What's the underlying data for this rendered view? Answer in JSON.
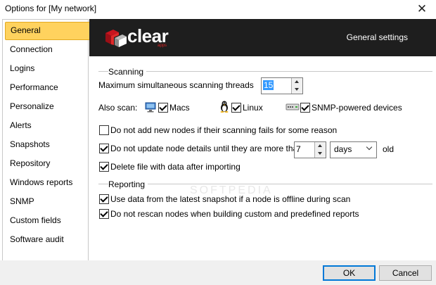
{
  "window": {
    "title": "Options for [My network]",
    "close_glyph": "✕"
  },
  "sidebar": {
    "items": [
      {
        "label": "General",
        "selected": true
      },
      {
        "label": "Connection"
      },
      {
        "label": "Logins"
      },
      {
        "label": "Performance"
      },
      {
        "label": "Personalize"
      },
      {
        "label": "Alerts"
      },
      {
        "label": "Snapshots"
      },
      {
        "label": "Repository"
      },
      {
        "label": "Windows reports"
      },
      {
        "label": "SNMP"
      },
      {
        "label": "Custom fields"
      },
      {
        "label": "Software audit"
      }
    ]
  },
  "header": {
    "logo_text": "clear",
    "logo_sub": "apps",
    "title": "General settings"
  },
  "scanning": {
    "group_label": "Scanning",
    "threads_label": "Maximum simultaneous scanning threads",
    "threads_value": "15",
    "also_scan_label": "Also scan:",
    "macs_label": "Macs",
    "macs_checked": true,
    "linux_label": "Linux",
    "linux_checked": true,
    "snmp_label": "SNMP-powered devices",
    "snmp_checked": true,
    "no_add_label": "Do not add new nodes if their scanning fails for some reason",
    "no_add_checked": false,
    "no_update_label": "Do not update node details until they are more than",
    "no_update_checked": true,
    "age_value": "7",
    "age_unit": "days",
    "age_suffix": "old",
    "delete_label": "Delete file with data after importing",
    "delete_checked": true
  },
  "reporting": {
    "group_label": "Reporting",
    "latest_label": "Use data from the latest snapshot if a node is offline during scan",
    "latest_checked": true,
    "norescan_label": "Do not rescan nodes when building custom and predefined reports",
    "norescan_checked": true
  },
  "watermark": "SOFTPEDIA",
  "footer": {
    "ok_label": "OK",
    "cancel_label": "Cancel"
  },
  "colors": {
    "selected_nav": "#ffd25e",
    "header_bg": "#1e1e1e",
    "accent_red": "#c8141e",
    "default_button_border": "#0078d7"
  }
}
